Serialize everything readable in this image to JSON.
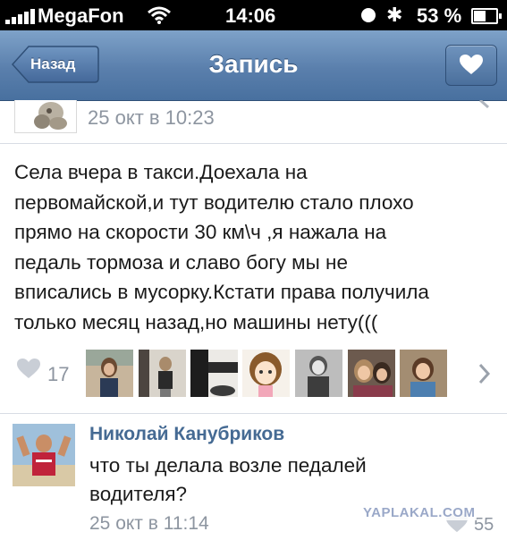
{
  "status_bar": {
    "carrier": "MegaFon",
    "time": "14:06",
    "battery": "53 %",
    "icons": [
      "signal-icon",
      "wifi-icon",
      "rotation-lock-icon",
      "bluetooth-icon",
      "battery-icon"
    ]
  },
  "navbar": {
    "back_label": "Назад",
    "title": "Запись",
    "right_icon": "heart-icon"
  },
  "post": {
    "date": "25 окт в 10:23",
    "text_lines": [
      "Села вчера в такси.Доехала на",
      "первомайской,и тут водителю стало плохо",
      "прямо на скорости 30 км\\ч ,я нажала на",
      "педаль тормоза и славо богу мы не",
      "вписались в мусорку.Кстати права получила",
      "только месяц назад,но машины нету((("
    ],
    "like_count": "17"
  },
  "comment": {
    "author": "Николай Канубриков",
    "text_lines": [
      "что ты делала возле педалей",
      "водителя?"
    ],
    "date": "25 окт в 11:14",
    "like_count": "55"
  },
  "watermark": "YAPLAKAL.COM",
  "colors": {
    "navbar": "#5a7fac",
    "name": "#456a93",
    "meta": "#8d95a0"
  }
}
